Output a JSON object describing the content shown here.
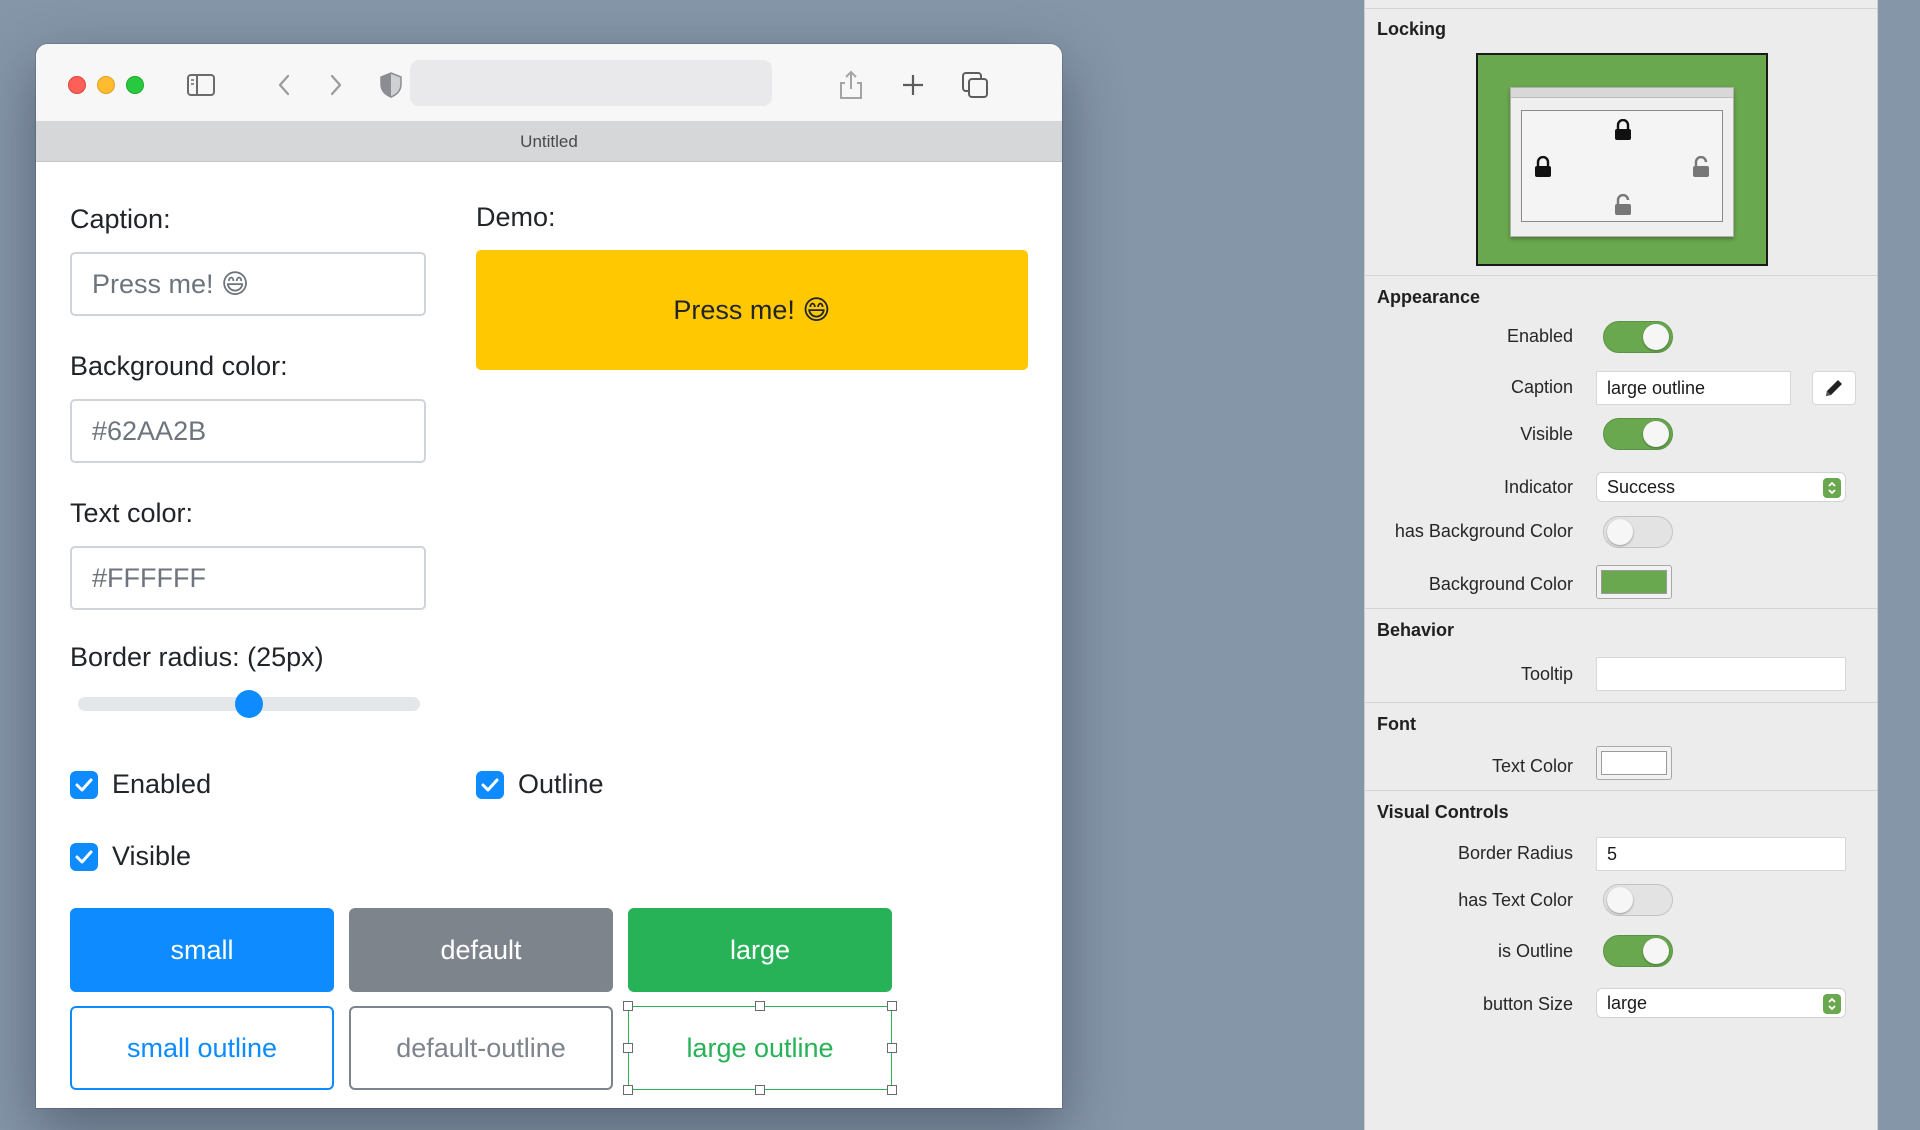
{
  "window": {
    "tab_title": "Untitled"
  },
  "form": {
    "caption_label": "Caption:",
    "caption_value": "Press me! 😄",
    "bg_label": "Background color:",
    "bg_value": "#62AA2B",
    "text_color_label": "Text color:",
    "text_color_value": "#FFFFFF",
    "radius_label": "Border radius: (25px)",
    "slider_value": 0.5,
    "enabled_label": "Enabled",
    "visible_label": "Visible",
    "outline_label": "Outline"
  },
  "demo": {
    "label": "Demo:",
    "button_label": "Press me! 😄",
    "color": "#ffc800"
  },
  "buttons": [
    {
      "label": "small",
      "style": "solid",
      "color": "#0d8bff"
    },
    {
      "label": "default",
      "style": "solid",
      "color": "#7d848c"
    },
    {
      "label": "large",
      "style": "solid",
      "color": "#28b257"
    },
    {
      "label": "small outline",
      "style": "outline",
      "color": "#0d8bff"
    },
    {
      "label": "default-outline",
      "style": "outline",
      "color": "#7d848c"
    },
    {
      "label": "large outline",
      "style": "outline",
      "color": "#28b257"
    }
  ],
  "inspector": {
    "locking": {
      "title": "Locking"
    },
    "appearance": {
      "title": "Appearance",
      "enabled_label": "Enabled",
      "caption_label": "Caption",
      "caption_value": "large outline",
      "visible_label": "Visible",
      "indicator_label": "Indicator",
      "indicator_value": "Success",
      "has_bg_label": "has Background Color",
      "bg_color_label": "Background Color",
      "bg_color": "#6aa84f"
    },
    "behavior": {
      "title": "Behavior",
      "tooltip_label": "Tooltip",
      "tooltip_value": ""
    },
    "font": {
      "title": "Font",
      "text_color_label": "Text Color",
      "text_color": "#ffffff"
    },
    "visual": {
      "title": "Visual Controls",
      "border_radius_label": "Border Radius",
      "border_radius_value": "5",
      "has_text_color_label": "has Text Color",
      "is_outline_label": "is Outline",
      "button_size_label": "button Size",
      "button_size_value": "large"
    },
    "accent_color": "#6aa84f"
  }
}
